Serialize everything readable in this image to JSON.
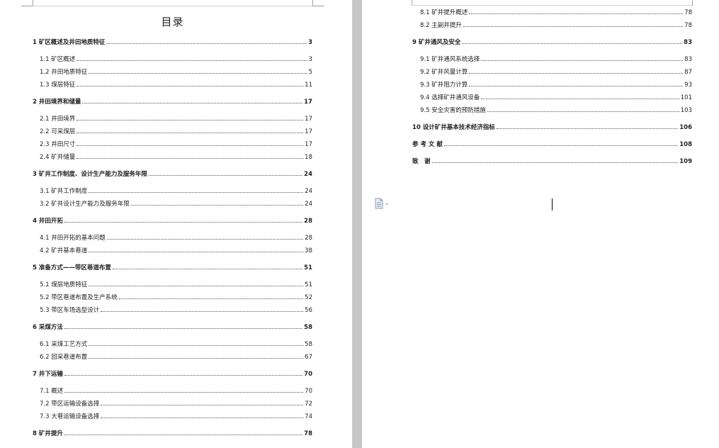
{
  "left_page": {
    "title": "目录",
    "entries": [
      {
        "level": 1,
        "text": "1 矿区概述及井田地质特征",
        "page": "3"
      },
      {
        "level": 2,
        "text": "1.1 矿区概述",
        "page": "3"
      },
      {
        "level": 2,
        "text": "1.2 井田地质特征",
        "page": "5"
      },
      {
        "level": 2,
        "text": "1.3 煤层特征",
        "page": "11"
      },
      {
        "level": 1,
        "text": "2 井田境界和储量",
        "page": "17"
      },
      {
        "level": 2,
        "text": "2.1 井田境界",
        "page": "17"
      },
      {
        "level": 2,
        "text": "2.2 可采煤层",
        "page": "17"
      },
      {
        "level": 2,
        "text": "2.3 井田尺寸",
        "page": "17"
      },
      {
        "level": 2,
        "text": "2.4 矿井储量",
        "page": "18"
      },
      {
        "level": 1,
        "text": "3 矿井工作制度、设计生产能力及服务年限",
        "page": "24"
      },
      {
        "level": 2,
        "text": "3.1 矿井工作制度",
        "page": "24"
      },
      {
        "level": 2,
        "text": "3.2 矿井设计生产能力及服务年限",
        "page": "24"
      },
      {
        "level": 1,
        "text": "4 井田开拓",
        "page": "28"
      },
      {
        "level": 2,
        "text": "4.1 井田开拓的基本问题",
        "page": "28"
      },
      {
        "level": 2,
        "text": "4.2 矿井基本巷道",
        "page": "38"
      },
      {
        "level": 1,
        "text": "5 准备方式——带区巷道布置",
        "page": "51"
      },
      {
        "level": 2,
        "text": "5.1 煤层地质特征",
        "page": "51"
      },
      {
        "level": 2,
        "text": "5.2 带区巷道布置及生产系统",
        "page": "52"
      },
      {
        "level": 2,
        "text": "5.3 带区车场选型设计",
        "page": "56"
      },
      {
        "level": 1,
        "text": "6 采煤方法",
        "page": "58"
      },
      {
        "level": 2,
        "text": "6.1 采煤工艺方式",
        "page": "58"
      },
      {
        "level": 2,
        "text": "6.2 回采巷道布置",
        "page": "67"
      },
      {
        "level": 1,
        "text": "7 井下运输",
        "page": "70"
      },
      {
        "level": 2,
        "text": "7.1 概述",
        "page": "70"
      },
      {
        "level": 2,
        "text": "7.2 带区运输设备选择",
        "page": "72"
      },
      {
        "level": 2,
        "text": "7.3 大巷运输设备选择",
        "page": "74"
      },
      {
        "level": 1,
        "text": "8 矿井提升",
        "page": "78"
      }
    ]
  },
  "right_page": {
    "entries": [
      {
        "level": 2,
        "text": "8.1 矿井提升概述",
        "page": "78"
      },
      {
        "level": 2,
        "text": "8.2 主副井提升",
        "page": "78"
      },
      {
        "level": 1,
        "text": "9 矿井通风及安全",
        "page": "83"
      },
      {
        "level": 2,
        "text": "9.1 矿井通风系统选择",
        "page": "83"
      },
      {
        "level": 2,
        "text": "9.2 矿井风量计算",
        "page": "87"
      },
      {
        "level": 2,
        "text": "9.3 矿井阻力计算",
        "page": "93"
      },
      {
        "level": 2,
        "text": "9.4 选择矿井通风设备",
        "page": "101"
      },
      {
        "level": 2,
        "text": "9.5 安全灾害的预防措施",
        "page": "103"
      },
      {
        "level": 1,
        "text": "10 设计矿井基本技术经济指标",
        "page": "106"
      },
      {
        "level": 1,
        "text": "参 考 文 献",
        "page": "108"
      },
      {
        "level": 1,
        "text": "致　谢",
        "page": "109"
      }
    ]
  },
  "icons": {
    "paste_options": "document-paste-icon"
  }
}
